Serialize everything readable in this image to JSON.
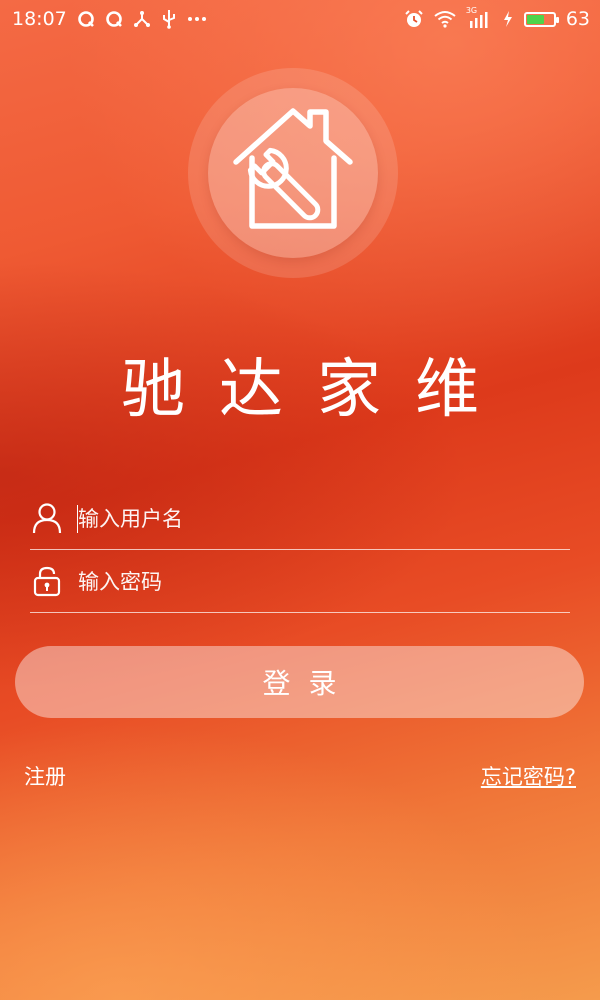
{
  "status_bar": {
    "time": "18:07",
    "network_type": "3G",
    "battery_level": "63",
    "battery_fraction": 0.63,
    "battery_color": "#4fd44a"
  },
  "app": {
    "title": "驰达家维"
  },
  "login_form": {
    "username_placeholder": "输入用户名",
    "password_placeholder": "输入密码",
    "login_label": "登录"
  },
  "links": {
    "register": "注册",
    "forgot_password": "忘记密码?"
  },
  "colors": {
    "background_top": "#f46a45",
    "background_mid": "#dd3a1b",
    "background_bottom": "#f59b4c"
  },
  "icons": {
    "logo": "house-wrench-icon",
    "user": "user-icon",
    "password": "lock-icon"
  }
}
